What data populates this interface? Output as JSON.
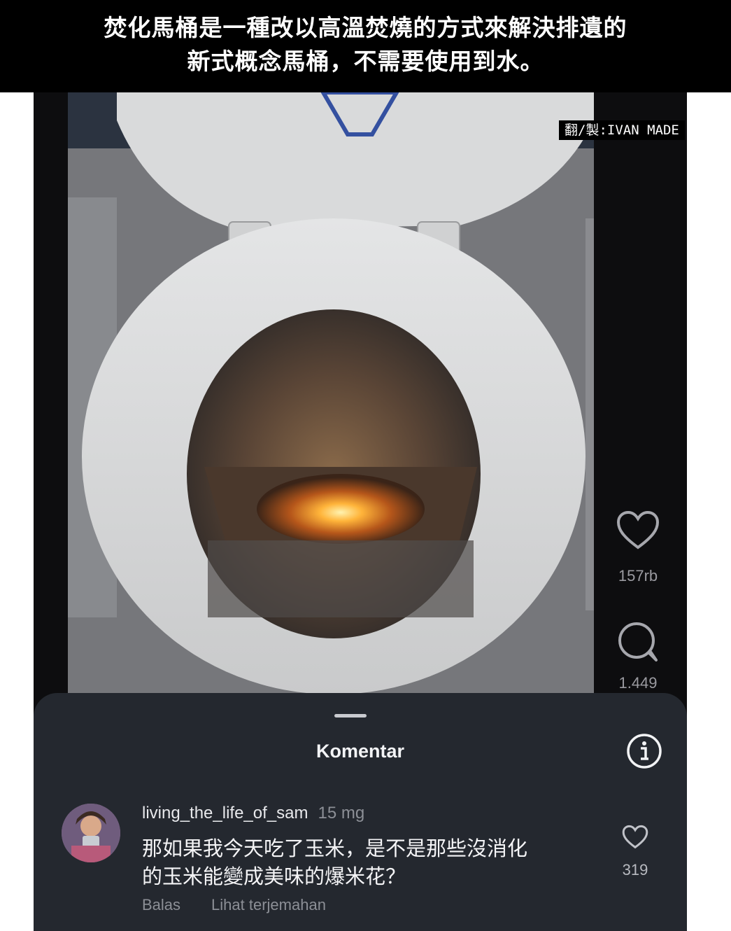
{
  "caption": {
    "line1": "焚化馬桶是一種改以高溫焚燒的方式來解決排遺的",
    "line2": "新式概念馬桶，不需要使用到水。"
  },
  "watermark": "翻/製:IVAN MADE",
  "rail": {
    "likes": "157rb",
    "comments": "1.449"
  },
  "sheet": {
    "title": "Komentar"
  },
  "comment": {
    "username": "living_the_life_of_sam",
    "time": "15 mg",
    "line1": "那如果我今天吃了玉米，是不是那些沒消化",
    "line2": "的玉米能變成美味的爆米花？",
    "reply": "Balas",
    "translate": "Lihat terjemahan",
    "like_count": "319"
  },
  "colors": {
    "sheet_bg": "#24282f",
    "frame_bg": "#0d0d0f",
    "flame": "#ffb43a"
  },
  "icons": [
    "heart-icon",
    "comment-bubble-icon",
    "info-icon",
    "heart-outline-icon"
  ]
}
